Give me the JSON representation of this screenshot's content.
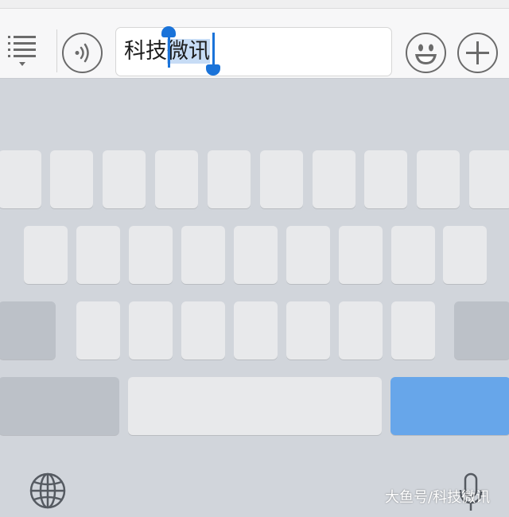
{
  "toolbar": {
    "menu_icon": "list-menu-icon",
    "voice_icon": "voice-wave-icon",
    "emoji_icon": "smiley-icon",
    "add_icon": "plus-icon"
  },
  "input": {
    "text_before_selection": "科技",
    "selected_text": "微讯",
    "selection_color": "#c7dcf5",
    "handle_color": "#1a73d9"
  },
  "keyboard": {
    "key_color": "#e8e9eb",
    "function_key_color": "#bcc1c8",
    "enter_key_color": "#67a6ea",
    "globe_icon": "globe-icon",
    "mic_icon": "microphone-icon"
  },
  "watermark": "大鱼号/科技微讯"
}
